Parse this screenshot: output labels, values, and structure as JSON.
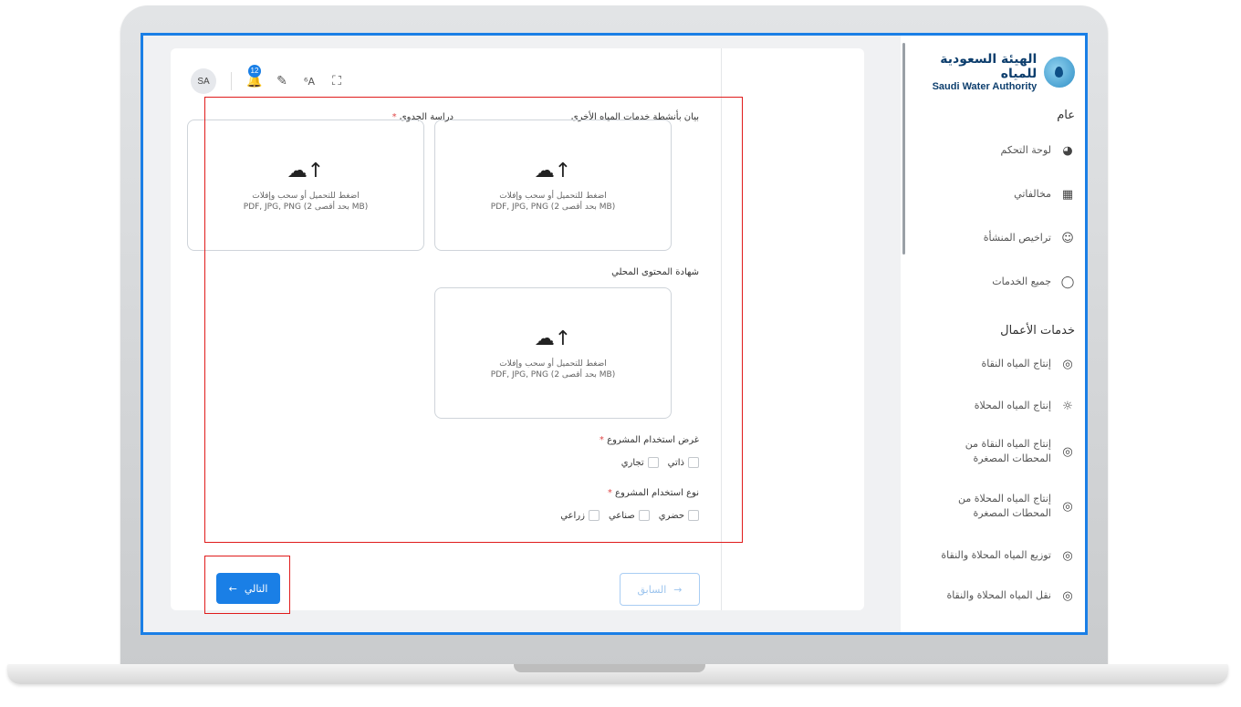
{
  "sidebar": {
    "logo_ar": "الهيئة السعودية للمياه",
    "logo_en": "Saudi Water Authority",
    "section_general": "عام",
    "general_items": [
      {
        "label": "لوحة التحكم",
        "icon": "dashboard-icon"
      },
      {
        "label": "مخالفاتي",
        "icon": "grid-icon"
      },
      {
        "label": "تراخيص المنشأة",
        "icon": "user-icon"
      },
      {
        "label": "جميع الخدمات",
        "icon": "drop-icon"
      }
    ],
    "section_business": "خدمات الأعمال",
    "business_items": [
      {
        "label": "إنتاج المياه النقاة",
        "icon": "water-drop-icon"
      },
      {
        "label": "إنتاج المياه المحلاة",
        "icon": "sun-icon"
      },
      {
        "label": "إنتاج المياه النقاة من المحطات المصغرة",
        "icon": "water-drop-icon"
      },
      {
        "label": "إنتاج المياه المحلاة من المحطات المصغرة",
        "icon": "water-drop-icon"
      },
      {
        "label": "توزيع المياه المحلاة والنقاة",
        "icon": "water-drop-icon"
      },
      {
        "label": "نقل المياه المحلاة والنقاة",
        "icon": "water-drop-icon"
      }
    ]
  },
  "topbar": {
    "avatar": "SA",
    "notification_count": "12"
  },
  "form": {
    "upload_other": {
      "label": "بيان بأنشطة خدمات المياه الأخرى",
      "text": "اضغط للتحميل أو سحب وإفلات",
      "hint": "PDF, JPG, PNG (بحد أقصى 2 MB)"
    },
    "upload_feasibility": {
      "label": "دراسة الجدوى",
      "required": "*",
      "text": "اضغط للتحميل أو سحب وإفلات",
      "hint": "PDF, JPG, PNG (بحد أقصى 2 MB)"
    },
    "upload_local": {
      "label": "شهادة المحتوى المحلي",
      "text": "اضغط للتحميل أو سحب وإفلات",
      "hint": "PDF, JPG, PNG (بحد أقصى 2 MB)"
    },
    "purpose": {
      "label": "غرض استخدام المشروع",
      "required": "*",
      "options": [
        "ذاتي",
        "تجاري"
      ]
    },
    "usage_type": {
      "label": "نوع استخدام المشروع",
      "required": "*",
      "options": [
        "حضري",
        "صناعي",
        "زراعي"
      ]
    }
  },
  "buttons": {
    "next": "التالي",
    "prev": "السابق"
  }
}
